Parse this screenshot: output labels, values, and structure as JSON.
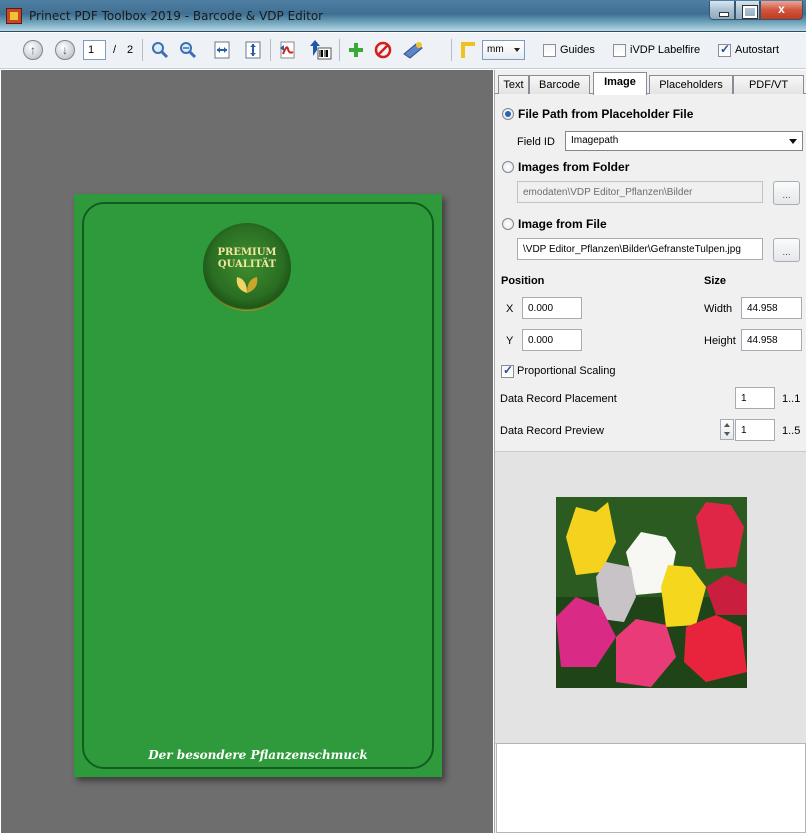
{
  "window": {
    "title": "Prinect PDF Toolbox 2019 - Barcode & VDP Editor",
    "min_icon": "minimize-icon",
    "max_icon": "maximize-icon",
    "close_glyph": "x"
  },
  "toolbar": {
    "page_current": "1",
    "page_sep": "/",
    "page_total": "2",
    "unit": "mm",
    "guides_label": "Guides",
    "guides_checked": false,
    "labelfire_label": "iVDP Labelfire",
    "labelfire_checked": false,
    "autostart_label": "Autostart",
    "autostart_checked": true,
    "icons": [
      "prev-page-icon",
      "next-page-icon",
      "zoom-in-icon",
      "zoom-out-icon",
      "fit-width-icon",
      "fit-height-icon",
      "pdf-export-icon",
      "barcode-import-icon",
      "add-icon",
      "delete-icon",
      "settings-icon",
      "ruler-icon"
    ]
  },
  "document": {
    "badge_line1": "PREMIUM",
    "badge_line2": "QUALITÄT",
    "footer_text": "Der besondere Pflanzenschmuck",
    "card_color": "#2f9a3b"
  },
  "tabs": [
    {
      "label": "Text",
      "active": false
    },
    {
      "label": "Barcode",
      "active": false
    },
    {
      "label": "Image",
      "active": true
    },
    {
      "label": "Placeholders",
      "active": false
    },
    {
      "label": "PDF/VT",
      "active": false
    }
  ],
  "image_panel": {
    "opt_placeholder_label": "File Path from Placeholder File",
    "opt_placeholder_selected": true,
    "field_id_label": "Field ID",
    "field_id_value": "Imagepath",
    "opt_folder_label": "Images from Folder",
    "opt_folder_selected": false,
    "folder_path": "emodaten\\VDP Editor_Pflanzen\\Bilder",
    "opt_file_label": "Image from File",
    "opt_file_selected": false,
    "file_path": "\\VDP Editor_Pflanzen\\Bilder\\GefransteTulpen.jpg",
    "browse_label": "...",
    "position_label": "Position",
    "size_label": "Size",
    "x_label": "X",
    "x_value": "0.000",
    "y_label": "Y",
    "y_value": "0.000",
    "width_label": "Width",
    "width_value": "44.958",
    "height_label": "Height",
    "height_value": "44.958",
    "proportional_label": "Proportional Scaling",
    "proportional_checked": true,
    "placement_label": "Data Record Placement",
    "placement_value": "1",
    "placement_range": "1..1",
    "preview_label": "Data Record Preview",
    "preview_value": "1",
    "preview_range": "1..5"
  }
}
